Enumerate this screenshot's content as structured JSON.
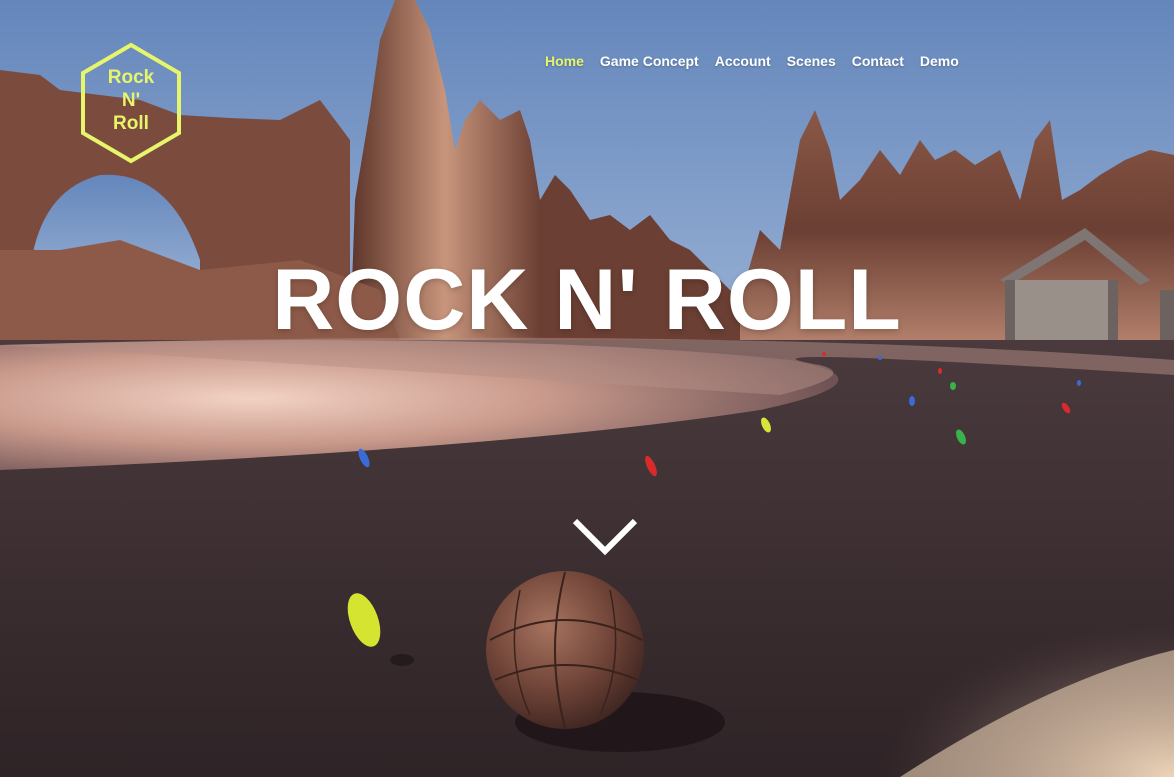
{
  "logo": {
    "line1": "Rock",
    "line2": "N'",
    "line3": "Roll",
    "color": "#e6f56a"
  },
  "nav": {
    "items": [
      {
        "label": "Home",
        "active": true
      },
      {
        "label": "Game Concept",
        "active": false
      },
      {
        "label": "Account",
        "active": false
      },
      {
        "label": "Scenes",
        "active": false
      },
      {
        "label": "Contact",
        "active": false
      },
      {
        "label": "Demo",
        "active": false
      }
    ],
    "active_color": "#e6f56a",
    "text_color": "#ffffff"
  },
  "hero": {
    "title": "ROCK N' ROLL",
    "scroll_icon": "chevron-down-icon"
  },
  "background": {
    "description_icon": "game-scene-background",
    "sky_color": "#6e8fbe",
    "ground_color": "#3e3033",
    "rock_color": "#7a4b3c"
  }
}
